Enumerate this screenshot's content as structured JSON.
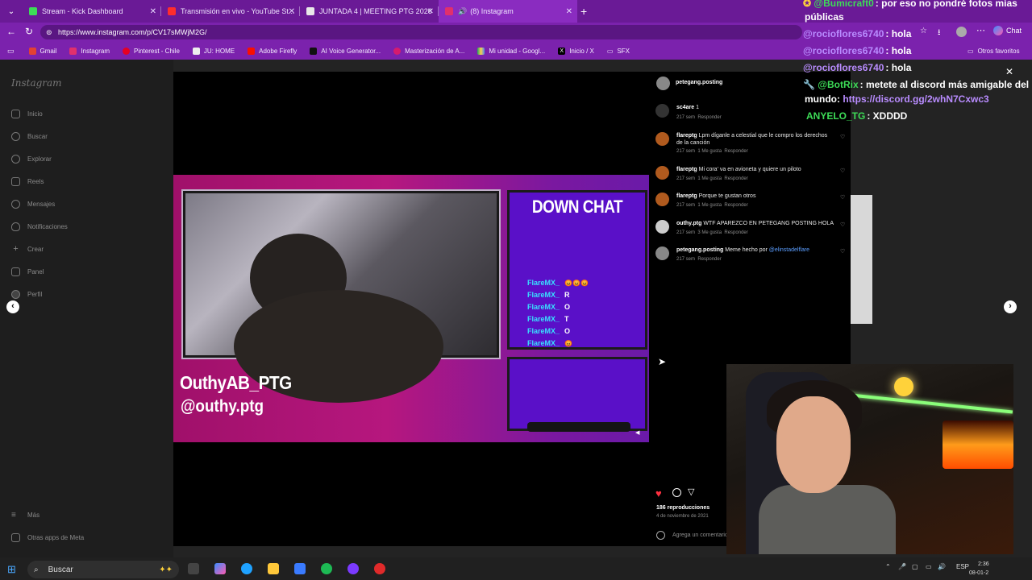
{
  "browser": {
    "tabs": [
      {
        "label": "Stream - Kick Dashboard",
        "color": "#3ddc57"
      },
      {
        "label": "Transmisión en vivo - YouTube St...",
        "color": "#ff2d2d"
      },
      {
        "label": "JUNTADA 4 | MEETING PTG 2026",
        "color": "#e8e8e8"
      },
      {
        "label": "(8) Instagram",
        "color": "#e1306c"
      }
    ],
    "new_tab": "+",
    "url": "https://www.instagram.com/p/CV17sMWjM2G/",
    "bookmarks": [
      "Gmail",
      "Instagram",
      "Pinterest - Chile",
      "JU: HOME",
      "Adobe Firefly",
      "AI Voice Generator...",
      "Masterización de A...",
      "Mi unidad - Googl...",
      "Inicio / X",
      "SFX"
    ],
    "bookmarks_other": "Otros favoritos",
    "chat_button": "Chat"
  },
  "instagram": {
    "logo": "Instagram",
    "nav": [
      "Inicio",
      "Buscar",
      "Explorar",
      "Reels",
      "Mensajes",
      "Notificaciones",
      "Crear",
      "Panel",
      "Perfil"
    ],
    "nav_bottom": [
      "Más",
      "Otras apps de Meta"
    ],
    "post_author": "petegang.posting",
    "comments": [
      {
        "user": "sc4are",
        "text": "1",
        "time": "217 sem",
        "likes": "",
        "reply": "Responder"
      },
      {
        "user": "flareptg",
        "text": "Lpm díganle a celestial que le compro los derechos de la canción",
        "time": "217 sem",
        "likes": "1 Me gusta",
        "reply": "Responder"
      },
      {
        "user": "flareptg",
        "text": "Mi cora' va en avioneta y quiere un piloto",
        "time": "217 sem",
        "likes": "1 Me gusta",
        "reply": "Responder"
      },
      {
        "user": "flareptg",
        "text": "Porque te gustan otros",
        "time": "217 sem",
        "likes": "1 Me gusta",
        "reply": "Responder"
      },
      {
        "user": "outhy.ptg",
        "text": "WTF APAREZCO EN PETEGANG POSTING HOLA",
        "time": "217 sem",
        "likes": "3 Me gusta",
        "reply": "Responder"
      },
      {
        "user": "petegang.posting",
        "text": "Meme hecho por",
        "mention": "@elinstadelflare",
        "time": "217 sem",
        "likes": "",
        "reply": "Responder"
      }
    ],
    "views": "186 reproducciones",
    "date": "4 de noviembre de 2021",
    "add_comment": "Agrega un comentario..."
  },
  "meme": {
    "chat_title": "DOWN CHAT",
    "chat_lines": [
      {
        "user": "FlareMX_",
        "msg": "😡😡😡"
      },
      {
        "user": "FlareMX_",
        "msg": "R"
      },
      {
        "user": "FlareMX_",
        "msg": "O"
      },
      {
        "user": "FlareMX_",
        "msg": "T"
      },
      {
        "user": "FlareMX_",
        "msg": "O"
      },
      {
        "user": "FlareMX_",
        "msg": "😡"
      }
    ],
    "name_line1": "OuthyAB_PTG",
    "name_line2": "@outhy.ptg"
  },
  "stream_chat": [
    {
      "user": "@Bumicraft0",
      "msg": ": por eso no pondré fotos mías",
      "msg2": "públicas",
      "color": "#3ddc57"
    },
    {
      "user": "@rocioflores6740",
      "msg": ": hola",
      "color": "#b98cff"
    },
    {
      "user": "@rocioflores6740",
      "msg": ": hola",
      "color": "#b98cff"
    },
    {
      "user": "@rocioflores6740",
      "msg": ": hola",
      "color": "#b98cff"
    },
    {
      "user": "@BotRix",
      "msg": ": metete al discord más amigable del",
      "msg2": "mundo:",
      "link": "https://discord.gg/2whN7Cxwc3",
      "color": "#3ddc57"
    },
    {
      "user": "ANYELO_TG",
      "msg": ": XDDDD",
      "color": "#3ddc57"
    }
  ],
  "taskbar": {
    "search": "Buscar",
    "lang": "ESP",
    "time": "2:36",
    "date": "08-01-2"
  }
}
